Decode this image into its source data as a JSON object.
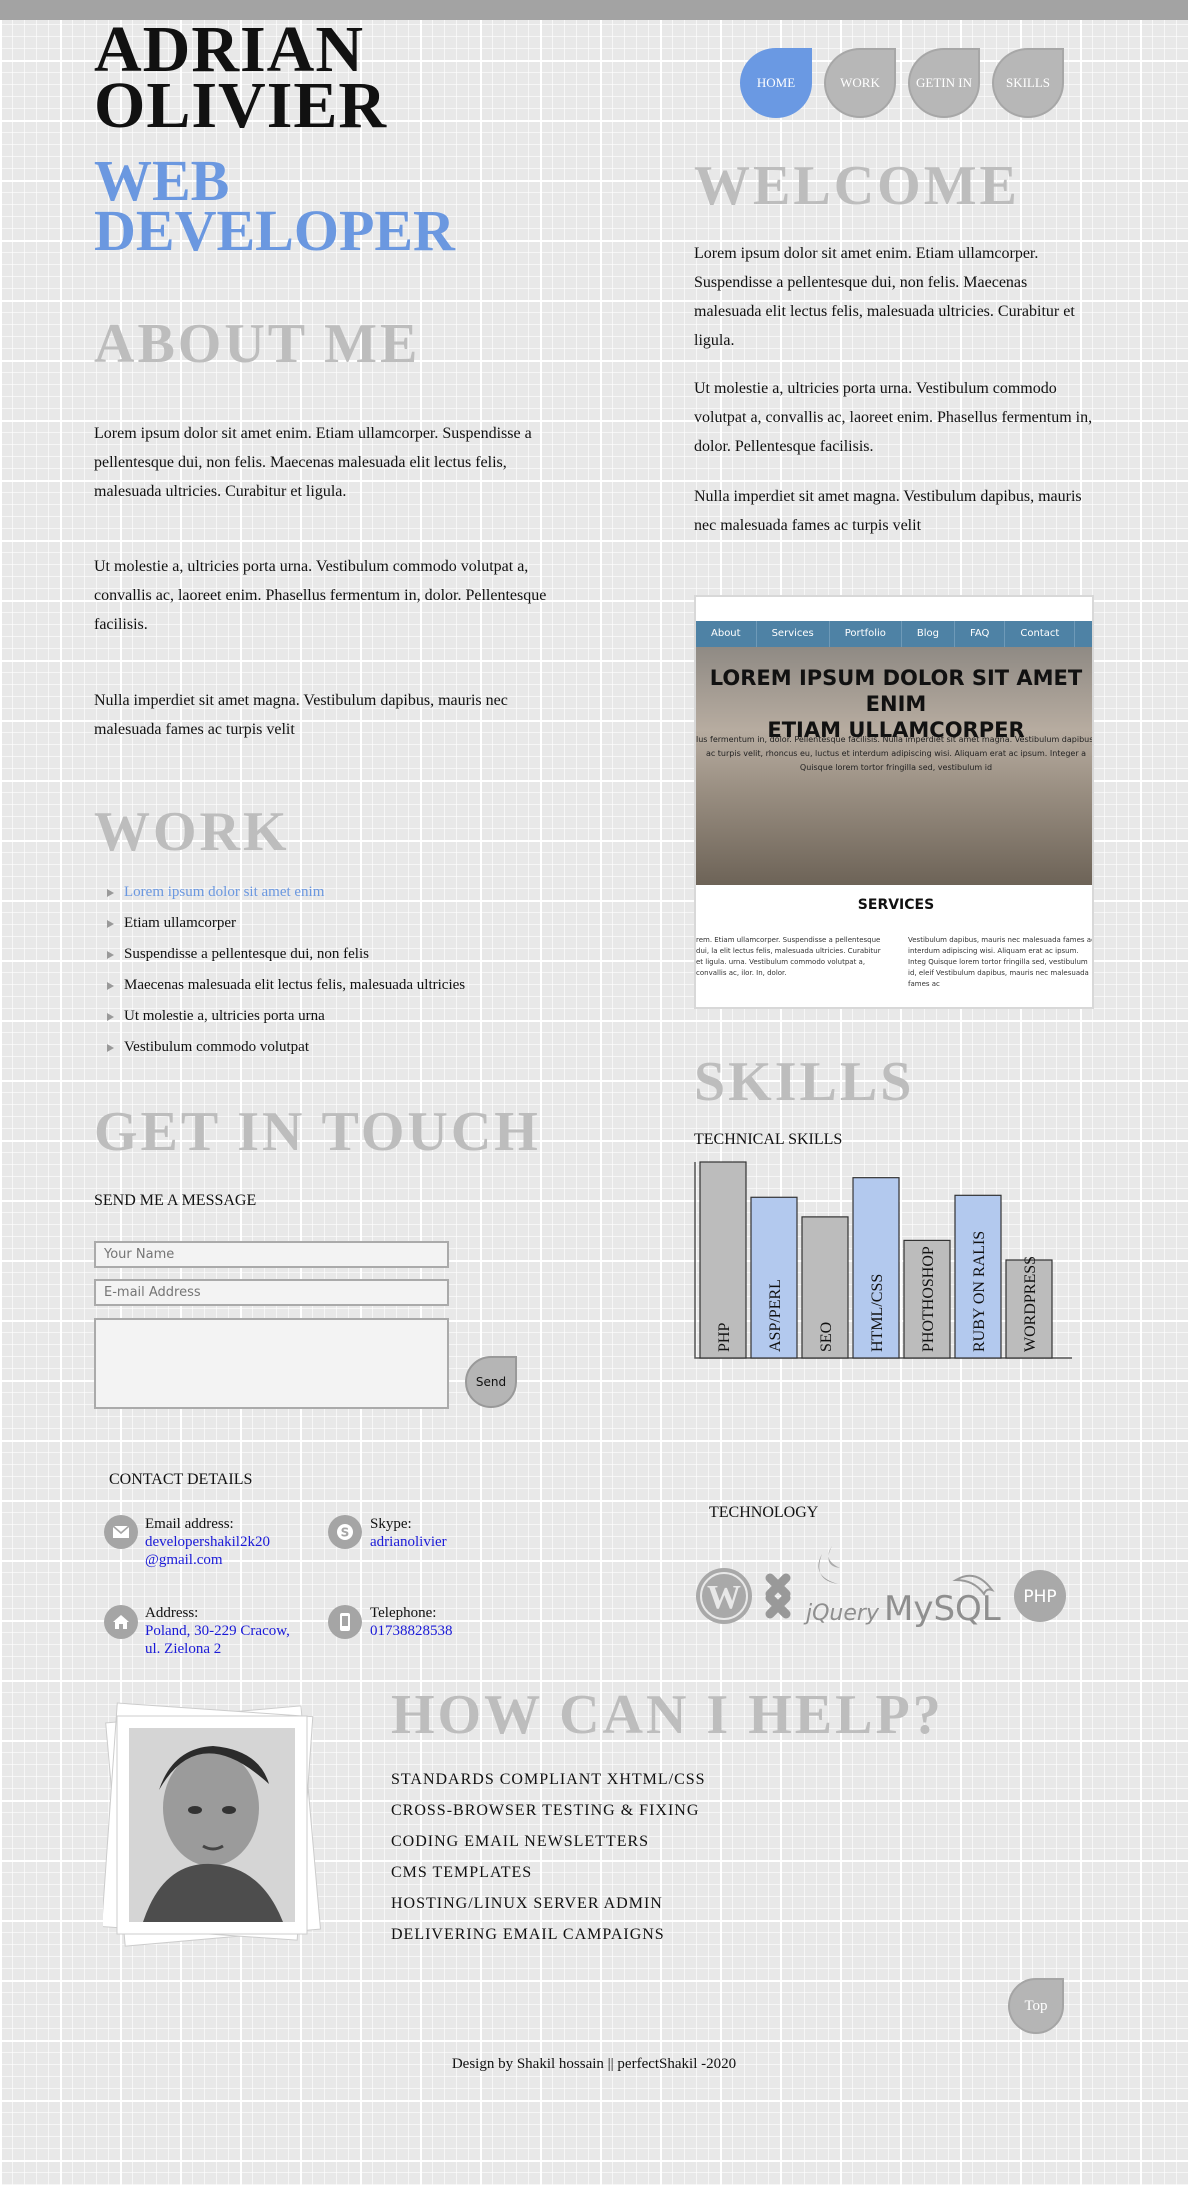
{
  "header": {
    "name_line1": "ADRIAN",
    "name_line2": "OLIVIER",
    "role_line1": "WEB",
    "role_line2": "DEVELOPER"
  },
  "nav": {
    "items": [
      {
        "label": "HOME",
        "active": true
      },
      {
        "label": "WORK",
        "active": false
      },
      {
        "label": "GETIN IN",
        "active": false
      },
      {
        "label": "SKILLS",
        "active": false
      }
    ]
  },
  "about": {
    "title": "ABOUT  ME",
    "paragraphs": [
      "Lorem ipsum dolor sit amet enim. Etiam ullamcorper. Suspendisse a pellentesque dui, non felis. Maecenas malesuada elit lectus felis, malesuada ultricies. Curabitur et ligula.",
      "Ut molestie a, ultricies porta urna. Vestibulum commodo volutpat a, convallis ac, laoreet enim. Phasellus fermentum in, dolor. Pellentesque facilisis.",
      "Nulla imperdiet sit amet magna. Vestibulum dapibus, mauris nec malesuada fames ac turpis velit"
    ]
  },
  "welcome": {
    "title": "WELCOME",
    "paragraphs": [
      "Lorem ipsum dolor sit amet enim. Etiam ullamcorper. Suspendisse a pellentesque dui, non felis. Maecenas malesuada elit lectus felis, malesuada ultricies. Curabitur et ligula.",
      "Ut molestie a, ultricies porta urna. Vestibulum commodo volutpat a, convallis ac, laoreet enim. Phasellus fermentum in, dolor. Pellentesque facilisis.",
      "Nulla imperdiet sit amet magna. Vestibulum dapibus, mauris nec malesuada fames ac turpis velit"
    ]
  },
  "work": {
    "title": "WORK",
    "items": [
      "Lorem ipsum dolor sit amet enim",
      "Etiam ullamcorper",
      "Suspendisse a pellentesque dui, non felis",
      "Maecenas malesuada elit lectus felis, malesuada ultricies",
      "Ut molestie a, ultricies porta urna",
      "Vestibulum commodo volutpat"
    ]
  },
  "preview": {
    "nav": [
      "About",
      "Services",
      "Portfolio",
      "Blog",
      "FAQ",
      "Contact"
    ],
    "hero_title_1": "LOREM IPSUM DOLOR SIT AMET ENIM",
    "hero_title_2": "ETIAM ULLAMCORPER",
    "hero_sub_1": "lus fermentum in, dolor. Pellentesque facilisis. Nulla imperdiet sit amet magna. Vestibulum dapibus, m",
    "hero_sub_2": "ac turpis velit, rhoncus eu, luctus et interdum adipiscing wisi. Aliquam erat ac ipsum. Integer a",
    "hero_sub_3": "Quisque lorem tortor fringilla sed, vestibulum id",
    "services": "SERVICES",
    "col1": "rem. Etiam ullamcorper. Suspendisse a pellentesque dui, la elit lectus felis, malesuada ultricies. Curabitur et ligula. urna. Vestibulum commodo volutpat a, convallis ac, ilor. In, dolor.",
    "col2": "Vestibulum dapibus, mauris nec malesuada fames ac interdum adipiscing wisi. Aliquam erat ac ipsum. Integ Quisque lorem tortor fringilla sed, vestibulum id, eleif Vestibulum dapibus, mauris nec malesuada fames ac"
  },
  "touch": {
    "title": "GET  IN  TOUCH",
    "subtitle": "SEND ME A MESSAGE",
    "name_placeholder": "Your Name",
    "email_placeholder": "E-mail Address",
    "send_label": "Send"
  },
  "skills": {
    "title": "SKILLS",
    "subtitle": "TECHNICAL SKILLS"
  },
  "chart_data": {
    "type": "bar",
    "title": "TECHNICAL SKILLS",
    "categories": [
      "PHP",
      "ASP/PERL",
      "SEO",
      "HTML/CSS",
      "PHOTHOSHOP",
      "RUBY ON RALIS",
      "WORDPRESS"
    ],
    "values": [
      100,
      82,
      72,
      92,
      60,
      83,
      50
    ],
    "ylim": [
      0,
      100
    ],
    "colors": [
      "#bcbcbc",
      "#b3c9ee",
      "#bcbcbc",
      "#b3c9ee",
      "#bcbcbc",
      "#b3c9ee",
      "#bcbcbc"
    ],
    "grid": false,
    "xlabel": "",
    "ylabel": ""
  },
  "contact": {
    "title": "CONTACT    DETAILS",
    "email_label": "Email address:",
    "email_line1": " developershakil2k20",
    "email_line2": "@gmail.com",
    "skype_label": "Skype:",
    "skype_value": " adrianolivier",
    "address_label": "Address:",
    "address_line1": " Poland, 30-229 Cracow,",
    "address_line2": "ul. Zielona 2",
    "phone_label": "Telephone:",
    "phone_value": " 01738828538",
    "link_color": "#1a1ad8"
  },
  "technology": {
    "title": "TECHNOLOGY",
    "jquery": "jQuery",
    "mysql": "MySQL",
    "php": "PHP"
  },
  "help": {
    "title": "HOW  CAN  I  HELP?",
    "items": [
      "STANDARDS  COMPLIANT  XHTML/CSS",
      "CROSS-BROWSER  TESTING  &  FIXING",
      "CODING  EMAIL  NEWSLETTERS",
      "CMS  TEMPLATES",
      "HOSTING/LINUX  SERVER  ADMIN",
      "DELIVERING  EMAIL  CAMPAIGNS"
    ]
  },
  "top_label": "Top",
  "footer": "Design by Shakil hossain || perfectShakil -2020",
  "colors": {
    "accent": "#6b98e0",
    "heading_gray": "#bdbdbd"
  }
}
